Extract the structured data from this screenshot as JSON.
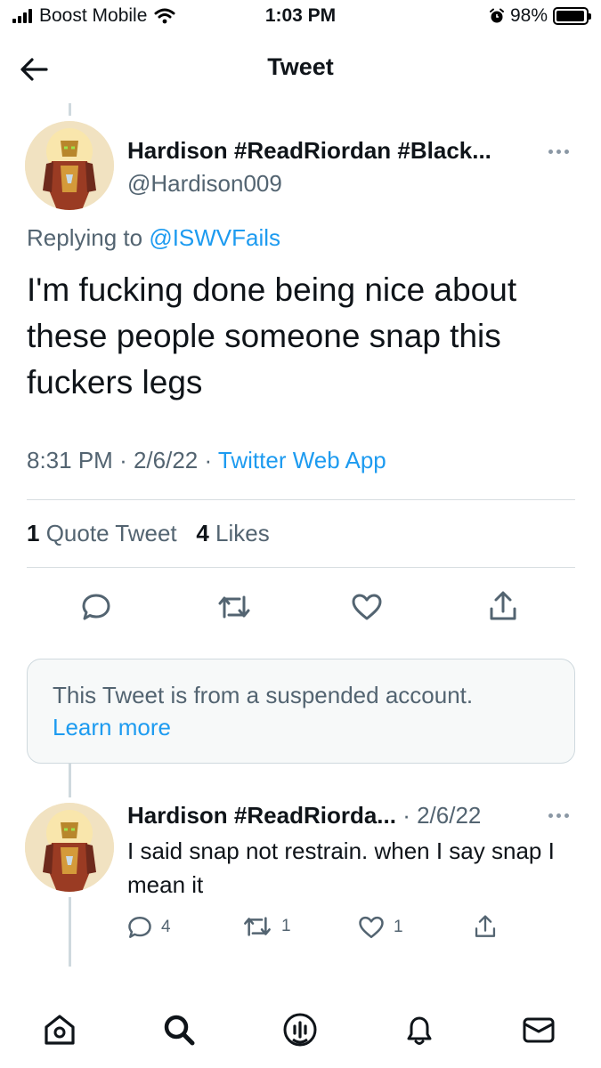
{
  "status_bar": {
    "carrier": "Boost Mobile",
    "time": "1:03 PM",
    "battery": "98%",
    "battery_level": 0.98
  },
  "header": {
    "title": "Tweet"
  },
  "tweet": {
    "author_name": "Hardison #ReadRiordan #Black...",
    "author_handle": "@Hardison009",
    "replying_prefix": "Replying to",
    "replying_to": "@ISWVFails",
    "text": "I'm fucking done being nice about these people someone snap this fuckers legs",
    "time": "8:31 PM",
    "date": "2/6/22",
    "source": "Twitter Web App",
    "quote_count": "1",
    "quote_label": "Quote Tweet",
    "like_count": "4",
    "like_label": "Likes"
  },
  "suspended_notice": {
    "text": "This Tweet is from a suspended account.",
    "link": "Learn more"
  },
  "reply": {
    "author_name": "Hardison #ReadRiorda...",
    "date": "· 2/6/22",
    "text": "I said snap not restrain. when I say snap I mean it",
    "reply_count": "4",
    "retweet_count": "1",
    "like_count": "1"
  },
  "icons": {
    "back": "arrow-left-icon",
    "reply": "speech-bubble-icon",
    "retweet": "retweet-icon",
    "like": "heart-icon",
    "share": "share-icon",
    "home": "home-icon",
    "search": "search-icon",
    "spaces": "spaces-icon",
    "notifications": "bell-icon",
    "messages": "envelope-icon"
  },
  "colors": {
    "accent": "#1d9bf0",
    "muted": "#536471",
    "text": "#0f1419"
  }
}
